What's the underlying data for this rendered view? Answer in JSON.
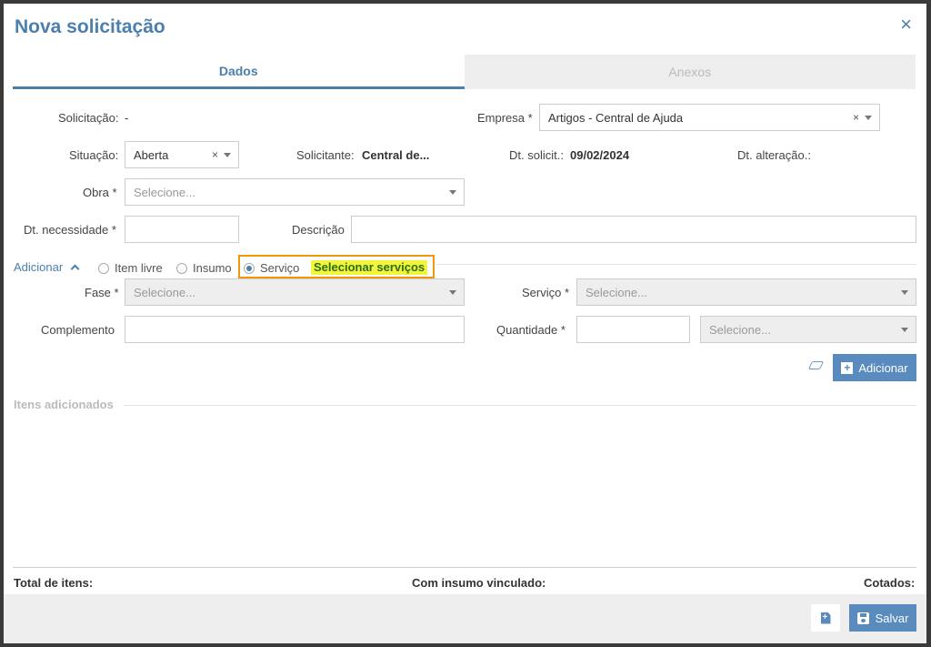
{
  "modal": {
    "title": "Nova solicitação",
    "close_label": "×"
  },
  "tabs": [
    {
      "label": "Dados",
      "active": true
    },
    {
      "label": "Anexos",
      "active": false
    }
  ],
  "form": {
    "solicitacao": {
      "label": "Solicitação:",
      "value": "-"
    },
    "empresa": {
      "label": "Empresa *",
      "value": "Artigos - Central de Ajuda"
    },
    "situacao": {
      "label": "Situação:",
      "value": "Aberta"
    },
    "solicitante": {
      "label": "Solicitante:",
      "value": "Central de..."
    },
    "dt_solicit": {
      "label": "Dt. solicit.:",
      "value": "09/02/2024"
    },
    "dt_alteracao": {
      "label": "Dt. alteração.:",
      "value": ""
    },
    "obra": {
      "label": "Obra *",
      "placeholder": "Selecione..."
    },
    "dt_necessidade": {
      "label": "Dt. necessidade *",
      "value": ""
    },
    "descricao": {
      "label": "Descrição",
      "value": ""
    }
  },
  "adicionar": {
    "label": "Adicionar",
    "options": [
      {
        "label": "Item livre",
        "selected": false
      },
      {
        "label": "Insumo",
        "selected": false
      },
      {
        "label": "Serviço",
        "selected": true
      }
    ],
    "select_services_link": "Selecionar serviços",
    "fase": {
      "label": "Fase *",
      "placeholder": "Selecione..."
    },
    "servico": {
      "label": "Serviço *",
      "placeholder": "Selecione..."
    },
    "complemento": {
      "label": "Complemento",
      "value": ""
    },
    "quantidade": {
      "label": "Quantidade *",
      "value": "",
      "unit_placeholder": "Selecione..."
    },
    "add_button": "Adicionar"
  },
  "items": {
    "title": "Itens adicionados",
    "total_label": "Total de itens:",
    "with_input_label": "Com insumo vinculado:",
    "quoted_label": "Cotados:"
  },
  "footer": {
    "save_button": "Salvar"
  },
  "colors": {
    "accent": "#4a7fae",
    "button": "#5a8bbf",
    "highlight_border": "#f2960a",
    "highlight_fill": "#f4f43a"
  }
}
